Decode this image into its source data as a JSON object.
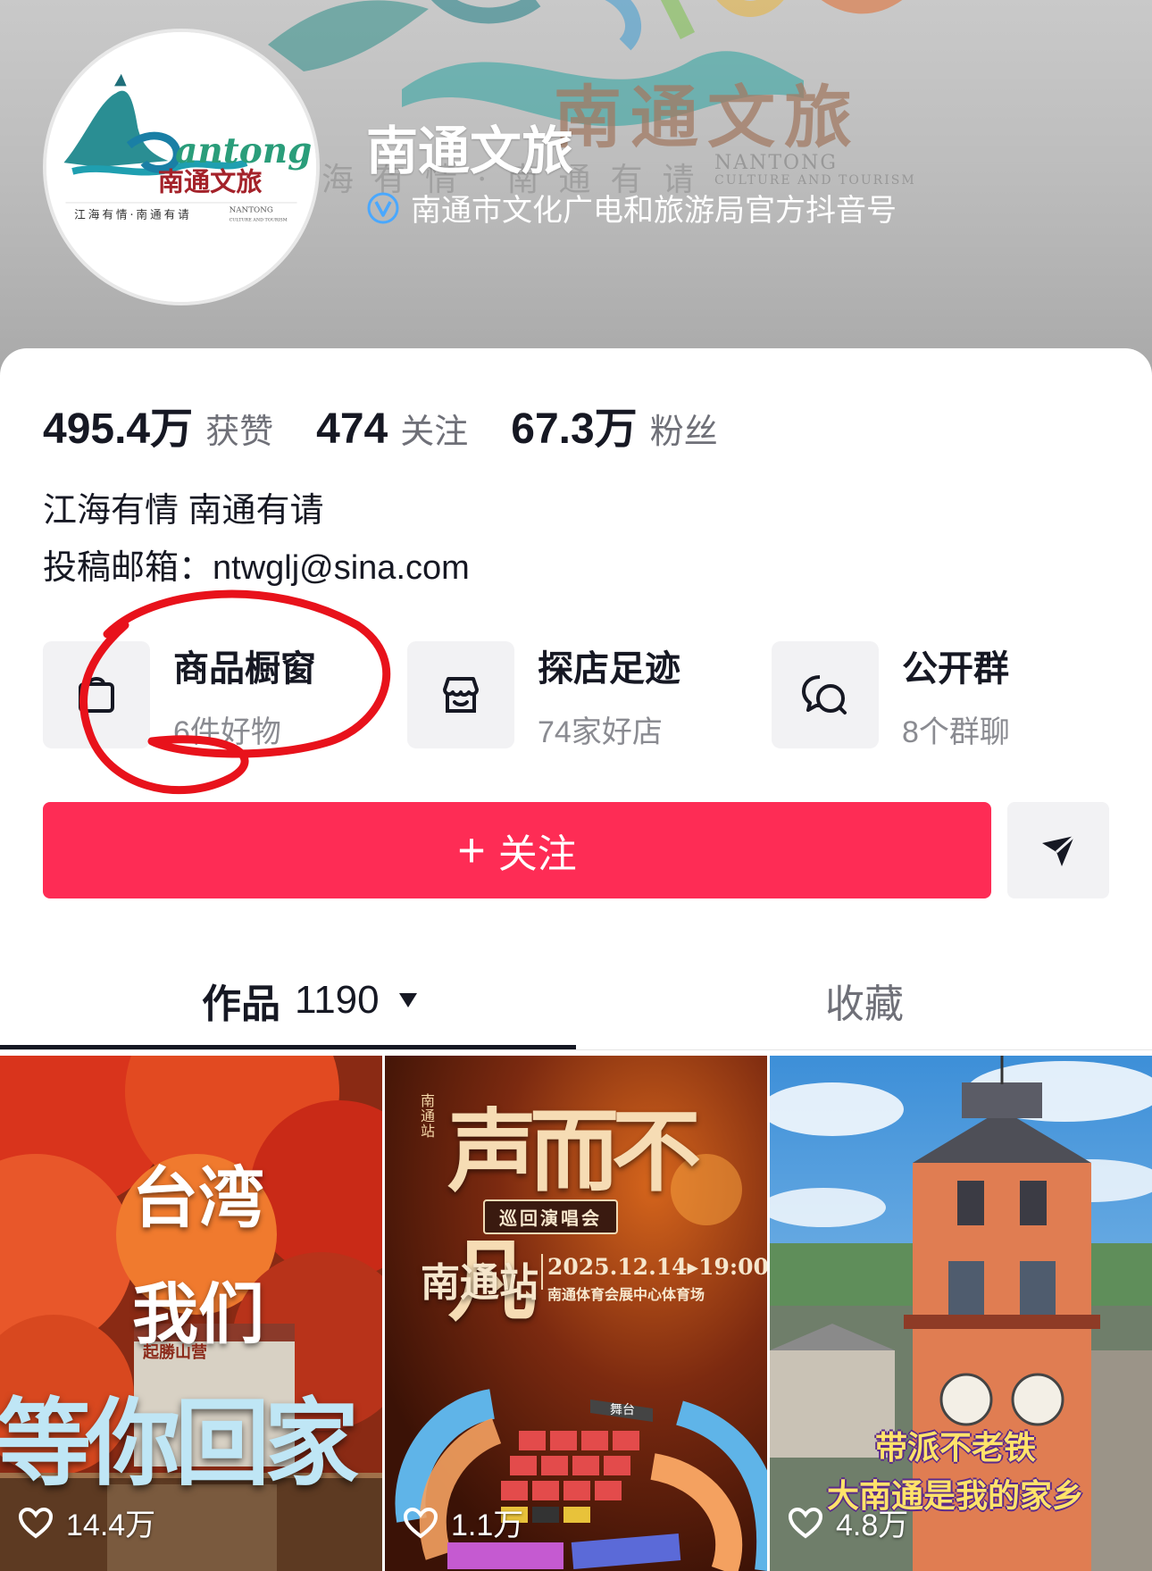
{
  "banner": {
    "watermark_cn": "南通文旅",
    "watermark_sub": "海有情·南通有请",
    "watermark_en_line1": "NANTONG",
    "watermark_en_line2": "CULTURE AND TOURISM"
  },
  "avatar": {
    "logo_text": "antong",
    "logo_cn": "南通文旅",
    "slogan": "江海有情·南通有请",
    "en_line1": "NANTONG",
    "en_line2": "CULTURE AND TOURISM"
  },
  "profile": {
    "name": "南通文旅",
    "verification": "南通市文化广电和旅游局官方抖音号"
  },
  "stats": [
    {
      "value": "495.4万",
      "label": "获赞"
    },
    {
      "value": "474",
      "label": "关注"
    },
    {
      "value": "67.3万",
      "label": "粉丝"
    }
  ],
  "bio": {
    "line1": "江海有情 南通有请",
    "line2": "投稿邮箱：ntwglj@sina.com"
  },
  "services": [
    {
      "title": "商品橱窗",
      "subtitle": "6件好物",
      "icon": "shopping-bag-icon"
    },
    {
      "title": "探店足迹",
      "subtitle": "74家好店",
      "icon": "storefront-icon"
    },
    {
      "title": "公开群",
      "subtitle": "8个群聊",
      "icon": "chat-bubbles-icon"
    }
  ],
  "actions": {
    "follow_plus": "+",
    "follow_label": "关注",
    "share_icon": "send-icon"
  },
  "tabs": {
    "works_label": "作品",
    "works_count": "1190",
    "favorites_label": "收藏"
  },
  "videos": [
    {
      "likes": "14.4万",
      "overlay_line1": "台湾",
      "overlay_line2": "我们",
      "overlay_line3": "等你回家",
      "sign_text": "起勝山营"
    },
    {
      "likes": "1.1万",
      "title": "声而不凡",
      "badge": "南通站",
      "subtitle": "巡回演唱会",
      "city": "南通站",
      "datetime": "2025.12.14▸19:00",
      "venue": "南通体育会展中心体育场",
      "stage": "舞台"
    },
    {
      "likes": "4.8万",
      "overlay_line1": "带派不老铁",
      "overlay_line2": "大南通是我的家乡"
    }
  ],
  "colors": {
    "accent": "#fe2c55",
    "verified": "#4aa8ff",
    "annotation": "#e8121b"
  }
}
